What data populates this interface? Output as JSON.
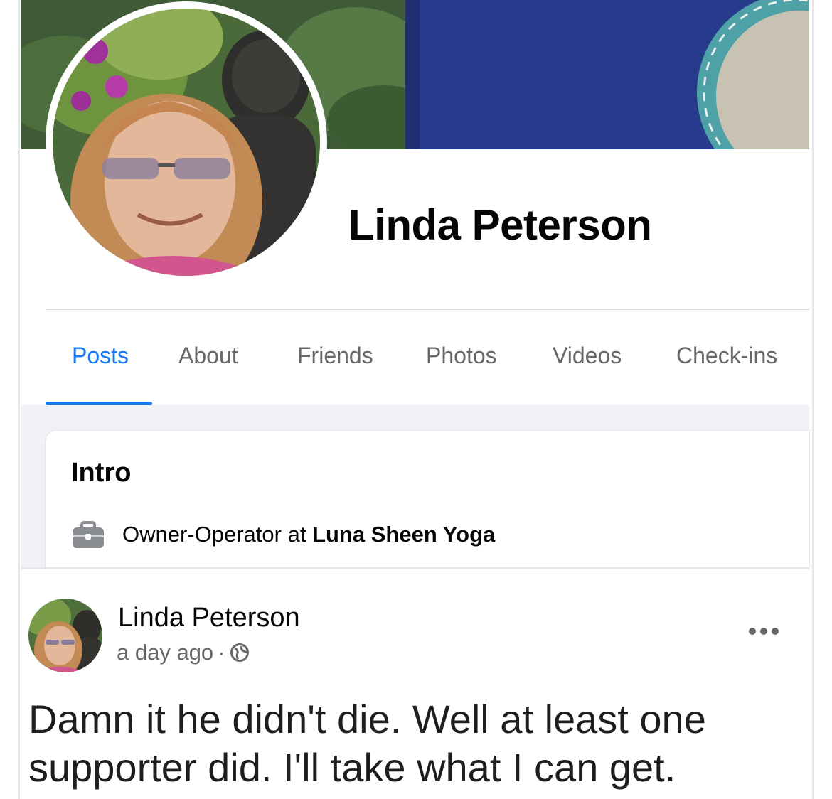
{
  "profile": {
    "name": "Linda Peterson"
  },
  "tabs": [
    {
      "label": "Posts",
      "active": true
    },
    {
      "label": "About",
      "active": false
    },
    {
      "label": "Friends",
      "active": false
    },
    {
      "label": "Photos",
      "active": false
    },
    {
      "label": "Videos",
      "active": false
    },
    {
      "label": "Check-ins",
      "active": false
    }
  ],
  "intro": {
    "title": "Intro",
    "work_prefix": "Owner-Operator at",
    "work_place": "Luna Sheen Yoga",
    "icon": "briefcase-icon"
  },
  "post": {
    "author": "Linda Peterson",
    "time": "a day ago",
    "separator": "·",
    "privacy_icon": "globe-icon",
    "menu_icon": "more-options-icon",
    "text": "Damn it he didn't die. Well at least one supporter did. I'll take what I can get."
  },
  "colors": {
    "accent": "#1877f2",
    "secondary_text": "#65676b",
    "primary_text": "#050505",
    "background_gray": "#f0f2f5"
  }
}
